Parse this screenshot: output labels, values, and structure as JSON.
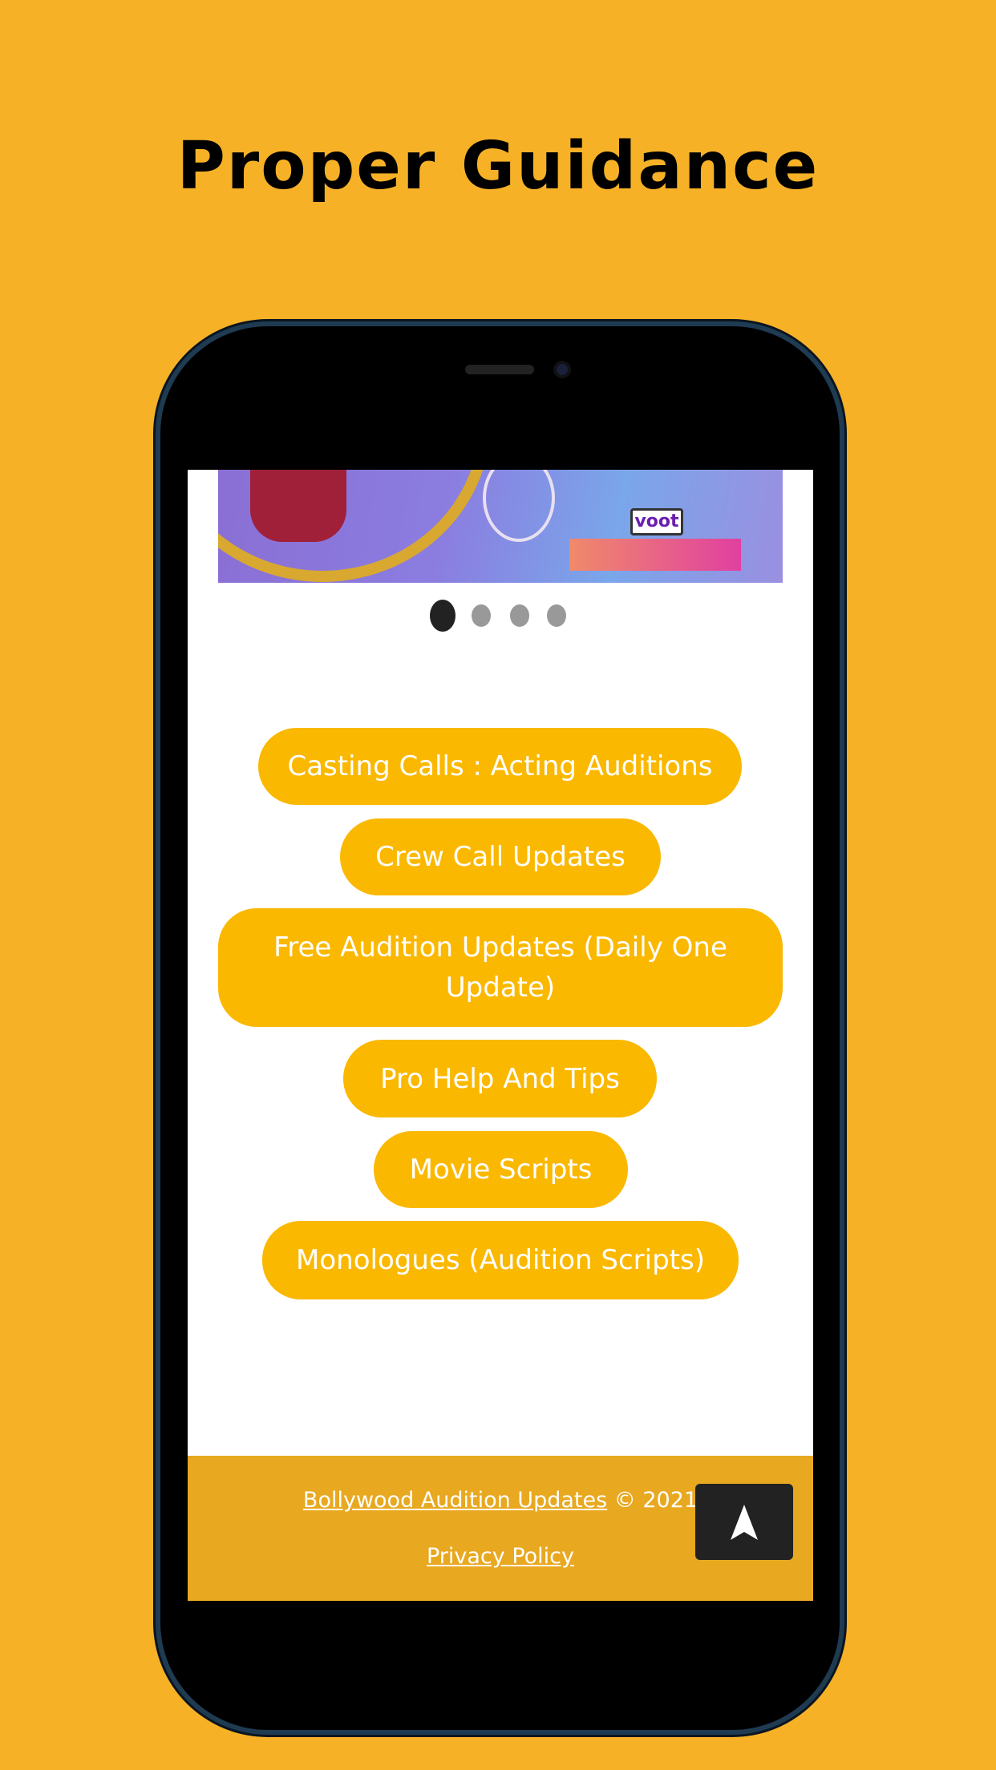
{
  "headline": "Proper Guidance",
  "banner": {
    "logo_text": "voot"
  },
  "carousel": {
    "total": 4,
    "active": 0
  },
  "menu": [
    {
      "label": "Casting Calls : Acting Auditions"
    },
    {
      "label": "Crew Call Updates"
    },
    {
      "label": "Free Audition Updates (Daily One Update)"
    },
    {
      "label": "Pro Help And Tips"
    },
    {
      "label": "Movie Scripts"
    },
    {
      "label": "Monologues (Audition Scripts)"
    }
  ],
  "footer": {
    "site_link": "Bollywood Audition Updates",
    "copyright": " © 2021",
    "privacy": "Privacy Policy",
    "back_to_top_icon": "arrow-up-icon"
  },
  "colors": {
    "background": "#F6B127",
    "button": "#FBB800",
    "footer": "#E8A820"
  }
}
